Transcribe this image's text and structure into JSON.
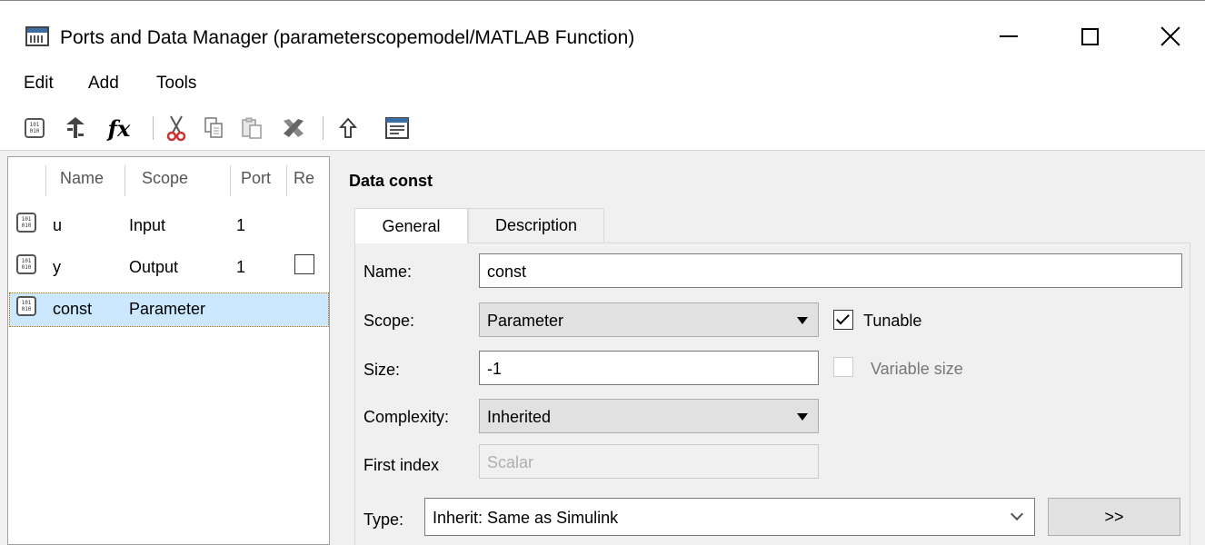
{
  "window": {
    "title": "Ports and Data Manager (parameterscopemodel/MATLAB Function)"
  },
  "menu": [
    "Edit",
    "Add",
    "Tools"
  ],
  "toolbar": {
    "fx_label": "fx",
    "icons": [
      "add-data-icon",
      "add-event-icon",
      "fx-icon",
      "cut-icon",
      "copy-icon",
      "paste-icon",
      "delete-icon",
      "up-arrow-icon",
      "properties-icon"
    ]
  },
  "table": {
    "headers": [
      "Name",
      "Scope",
      "Port",
      "Re"
    ],
    "rows": [
      {
        "name": "u",
        "scope": "Input",
        "port": "1"
      },
      {
        "name": "y",
        "scope": "Output",
        "port": "1"
      },
      {
        "name": "const",
        "scope": "Parameter",
        "port": ""
      }
    ],
    "selected_row": "const"
  },
  "details": {
    "title": "Data const",
    "tabs": [
      "General",
      "Description"
    ],
    "active_tab": "General",
    "labels": {
      "name": "Name:",
      "scope": "Scope:",
      "size": "Size:",
      "complexity": "Complexity:",
      "first_index": "First index",
      "type": "Type:"
    },
    "values": {
      "name": "const",
      "scope": "Parameter",
      "size": "-1",
      "complexity": "Inherited",
      "first_index": "Scalar",
      "type": "Inherit: Same as Simulink"
    },
    "checkboxes": {
      "tunable": "Tunable",
      "variable_size": "Variable size"
    },
    "type_button": ">>"
  },
  "colors": {
    "selection": "#cce8ff",
    "background": "#f0f0f0"
  }
}
